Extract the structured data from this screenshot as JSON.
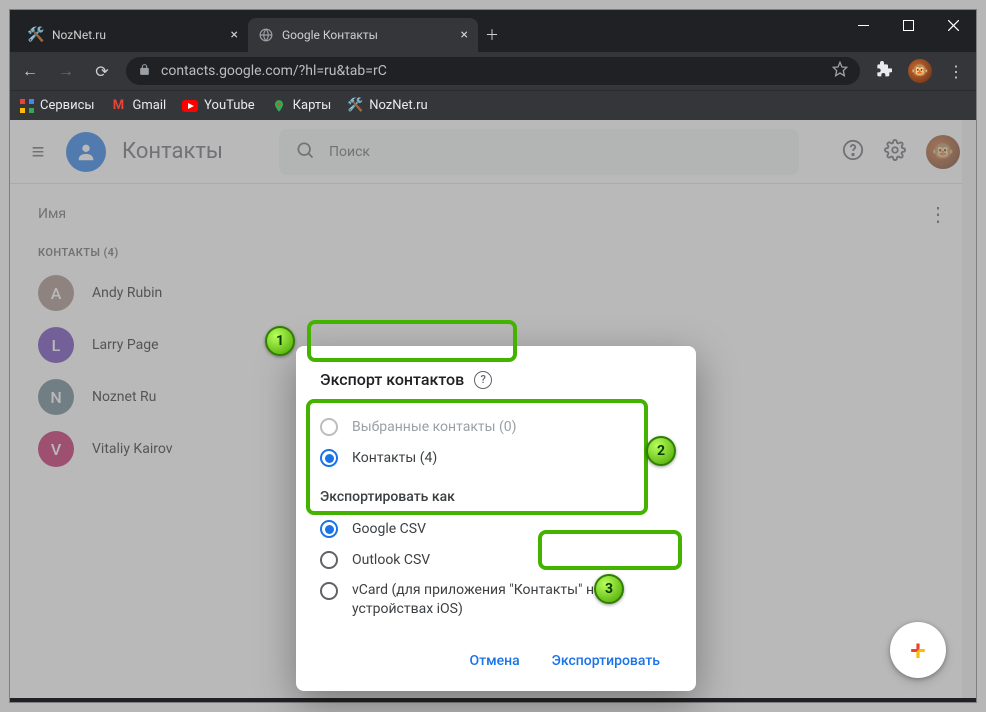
{
  "browser": {
    "tabs": [
      {
        "title": "NozNet.ru",
        "active": false
      },
      {
        "title": "Google Контакты",
        "active": true
      }
    ],
    "url": "contacts.google.com/?hl=ru&tab=rC",
    "bookmarks": [
      "Сервисы",
      "Gmail",
      "YouTube",
      "Карты",
      "NozNet.ru"
    ]
  },
  "app": {
    "title": "Контакты",
    "search_placeholder": "Поиск",
    "column_name": "Имя",
    "section_label": "КОНТАКТЫ (4)",
    "contacts": [
      {
        "initial": "A",
        "name": "Andy Rubin",
        "color": "#a1887f"
      },
      {
        "initial": "L",
        "name": "Larry Page",
        "color": "#673ab7"
      },
      {
        "initial": "N",
        "name": "Noznet Ru",
        "color": "#607d8b"
      },
      {
        "initial": "V",
        "name": "Vitaliy Kairov",
        "color": "#c2185b"
      }
    ]
  },
  "dialog": {
    "title": "Экспорт контактов",
    "opt_selected_disabled": "Выбранные контакты (0)",
    "opt_contacts": "Контакты (4)",
    "section": "Экспортировать как",
    "fmt_google": "Google CSV",
    "fmt_outlook": "Outlook CSV",
    "fmt_vcard": "vCard (для приложения \"Контакты\" на устройствах iOS)",
    "cancel": "Отмена",
    "export": "Экспортировать"
  },
  "badges": {
    "b1": "1",
    "b2": "2",
    "b3": "3"
  }
}
